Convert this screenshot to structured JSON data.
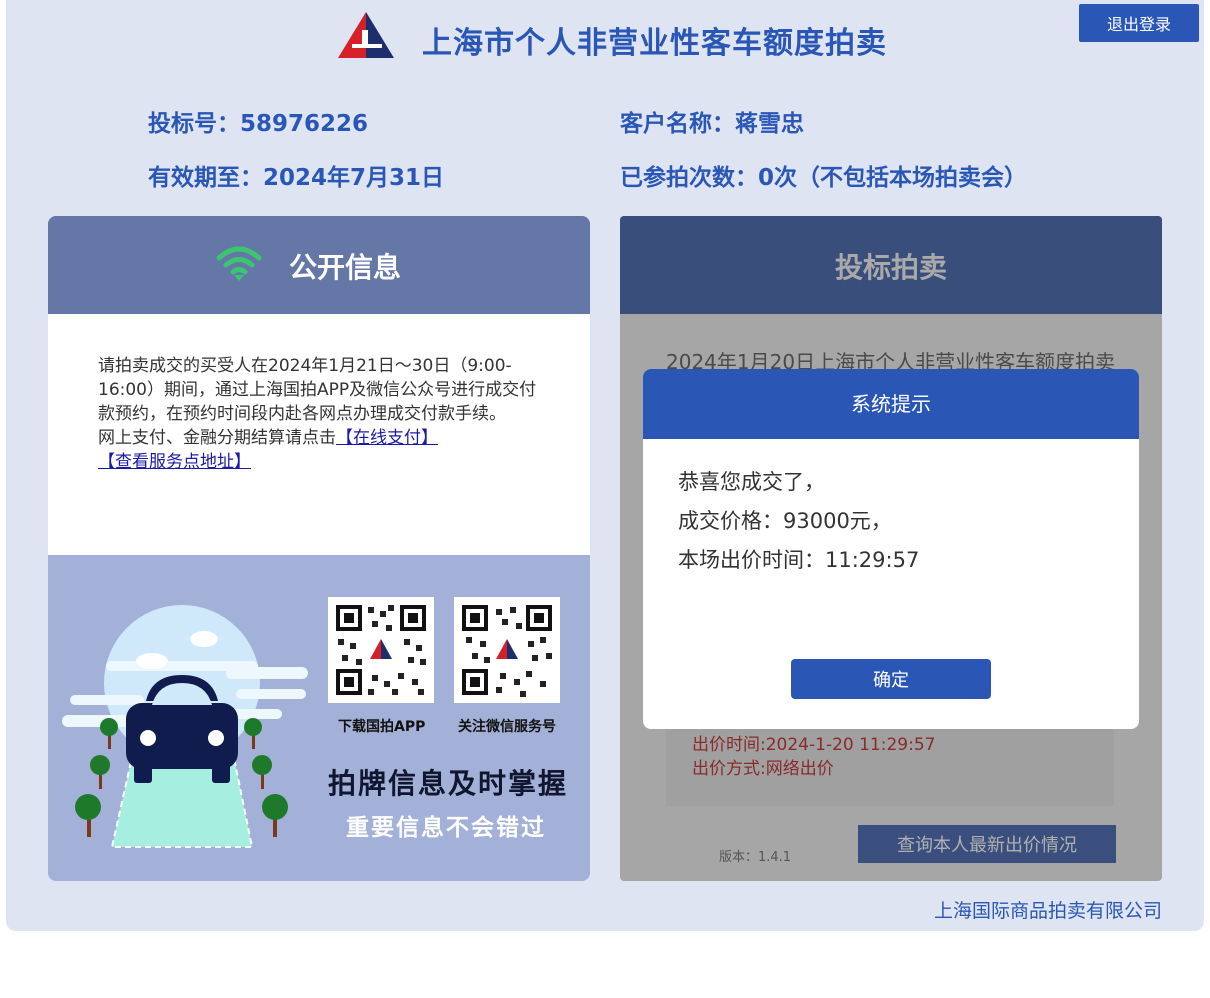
{
  "header": {
    "title": "上海市个人非营业性客车额度拍卖",
    "logout_label": "退出登录"
  },
  "account": {
    "bid_number": "投标号：58976226",
    "customer_name": "客户名称：蒋雪忠",
    "valid_until": "有效期至：2024年7月31日",
    "participation_count": "已参拍次数：0次（不包括本场拍卖会）"
  },
  "public_info": {
    "title": "公开信息",
    "notice_text": "请拍卖成交的买受人在2024年1月21日～30日（9:00-16:00）期间，通过上海国拍APP及微信公众号进行成交付款预约，在预约时间段内赴各网点办理成交付款手续。",
    "payment_text": "网上支付、金融分期结算请点击",
    "online_pay_link": "【在线支付】",
    "service_point_link": "【查看服务点地址】",
    "qr_app_label": "下载国拍APP",
    "qr_wechat_label": "关注微信服务号",
    "slogan_main": "拍牌信息及时掌握",
    "slogan_sub": "重要信息不会错过"
  },
  "bidding": {
    "title": "投标拍卖",
    "auction_name": "2024年1月20日上海市个人非营业性客车额度拍卖",
    "bid_time": "出价时间:2024-1-20 11:29:57",
    "bid_method": "出价方式:网络出价",
    "version": "版本：1.4.1",
    "query_label": "查询本人最新出价情况"
  },
  "modal": {
    "title": "系统提示",
    "line1": "恭喜您成交了，",
    "line2": "成交价格：93000元，",
    "line3": "本场出价时间：11:29:57",
    "confirm_label": "确定"
  },
  "footer": {
    "company": "上海国际商品拍卖有限公司"
  },
  "colors": {
    "brand_blue": "#2a57b5",
    "panel_header": "#6577a7",
    "bid_header": "#3a4e7c",
    "wifi_green": "#3cc470"
  },
  "icons": [
    "logo-icon",
    "wifi-icon",
    "qr-code-app",
    "qr-code-wechat",
    "car-illustration"
  ]
}
